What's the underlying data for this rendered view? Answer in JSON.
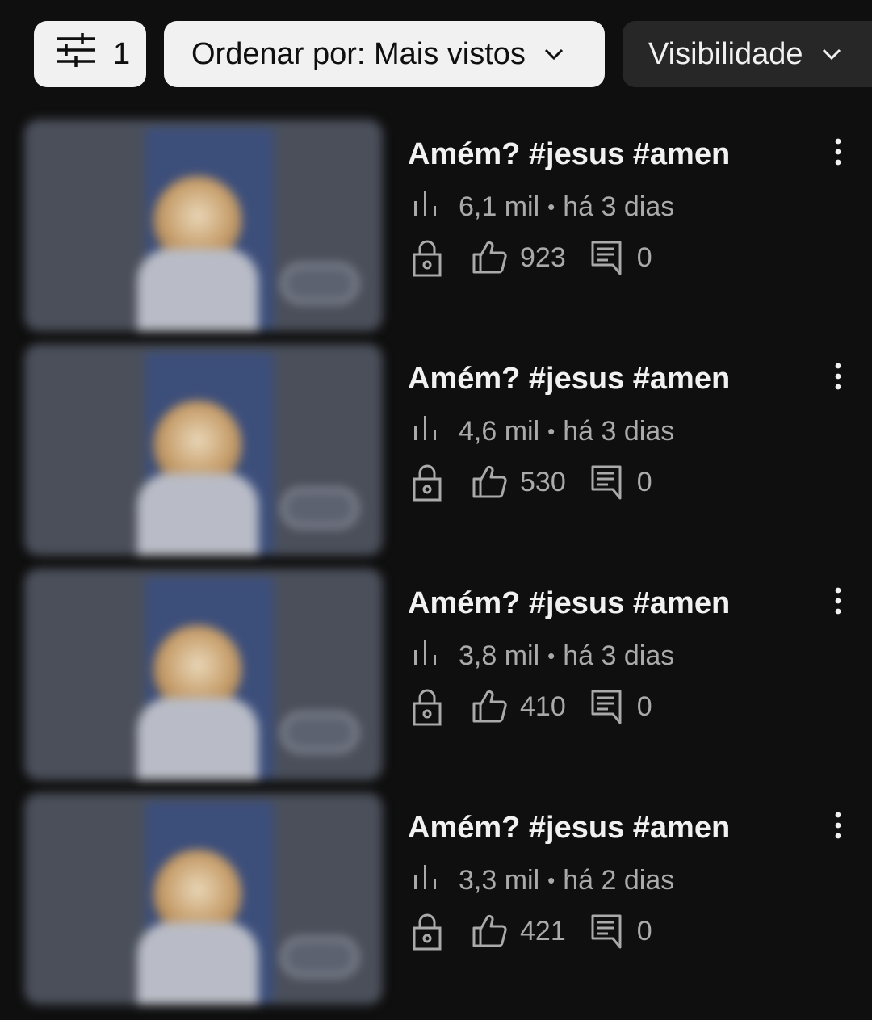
{
  "filters": {
    "filter_count": "1",
    "sort_label": "Ordenar por: Mais vistos",
    "visibility_label": "Visibilidade"
  },
  "videos": [
    {
      "title": "Amém? #jesus #amen",
      "views": "6,1 mil",
      "separator": "•",
      "age": "há 3 dias",
      "likes": "923",
      "comments": "0"
    },
    {
      "title": "Amém? #jesus #amen",
      "views": "4,6 mil",
      "separator": "•",
      "age": "há 3 dias",
      "likes": "530",
      "comments": "0"
    },
    {
      "title": "Amém? #jesus #amen",
      "views": "3,8 mil",
      "separator": "•",
      "age": "há 3 dias",
      "likes": "410",
      "comments": "0"
    },
    {
      "title": "Amém? #jesus #amen",
      "views": "3,3 mil",
      "separator": "•",
      "age": "há 2 dias",
      "likes": "421",
      "comments": "0"
    }
  ],
  "icons": {
    "filter": "sliders-icon",
    "chevron": "chevron-down-icon",
    "views": "bar-chart-icon",
    "visibility": "lock-icon",
    "likes": "thumbs-up-icon",
    "comments": "comment-icon",
    "more": "more-vert-icon"
  },
  "colors": {
    "background": "#0f0f0f",
    "chip_light": "#f1f1f1",
    "chip_dark": "#272727",
    "text_primary": "#f1f1f1",
    "text_secondary": "#aaaaaa"
  }
}
